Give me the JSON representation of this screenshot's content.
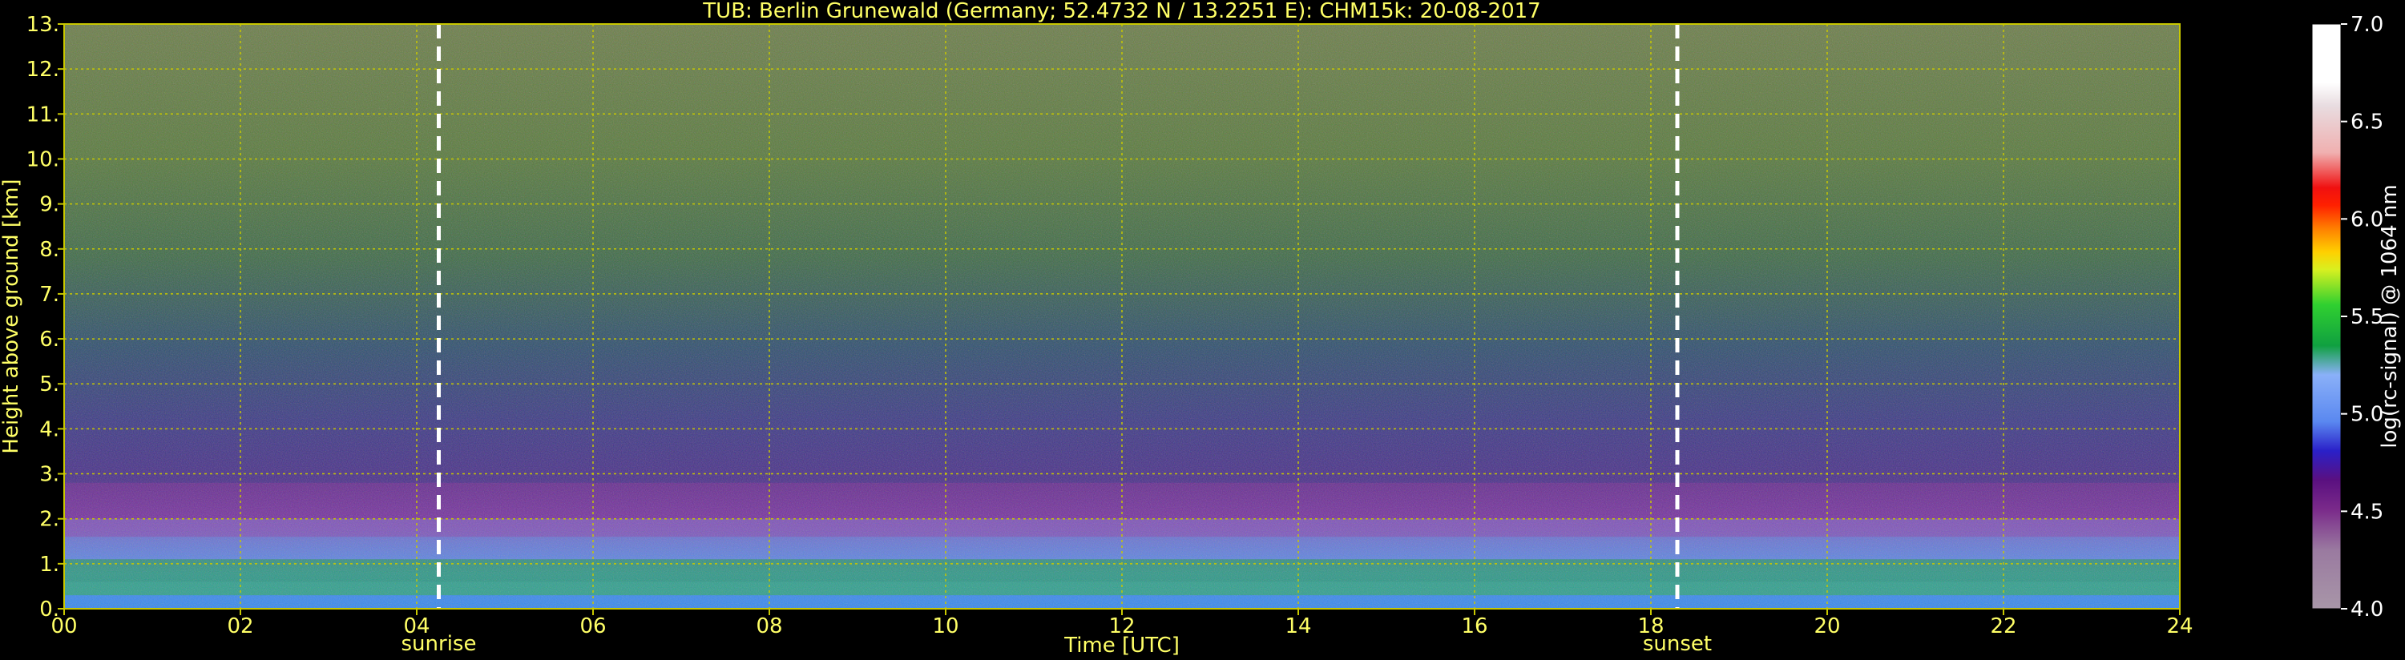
{
  "chart_data": {
    "type": "heatmap",
    "title": "TUB: Berlin Grunewald (Germany; 52.4732 N / 13.2251 E):    CHM15k: 20-08-2017",
    "xlabel": "Time [UTC]",
    "ylabel": "Height above ground [km]",
    "xlim": [
      0,
      24
    ],
    "ylim": [
      0,
      13
    ],
    "x_ticks": [
      "00",
      "02",
      "04",
      "06",
      "08",
      "10",
      "12",
      "14",
      "16",
      "18",
      "20",
      "22",
      "24"
    ],
    "y_ticks": [
      "0.",
      "1.",
      "2.",
      "3.",
      "4.",
      "5.",
      "6.",
      "7.",
      "8.",
      "9.",
      "10.",
      "11.",
      "12.",
      "13."
    ],
    "grid": true,
    "colorbar": {
      "label": "log(rc-signal) @ 1064 nm",
      "range": [
        4.0,
        7.0
      ],
      "ticks": [
        "4.0",
        "4.5",
        "5.0",
        "5.5",
        "6.0",
        "6.5",
        "7.0"
      ]
    },
    "annotations": [
      {
        "label": "sunrise",
        "x": 4.25
      },
      {
        "label": "sunset",
        "x": 18.3
      }
    ],
    "colors": {
      "text": "#ffff66",
      "grid": "#c8c800",
      "marker": "#ffffff",
      "background": "#000000"
    }
  }
}
